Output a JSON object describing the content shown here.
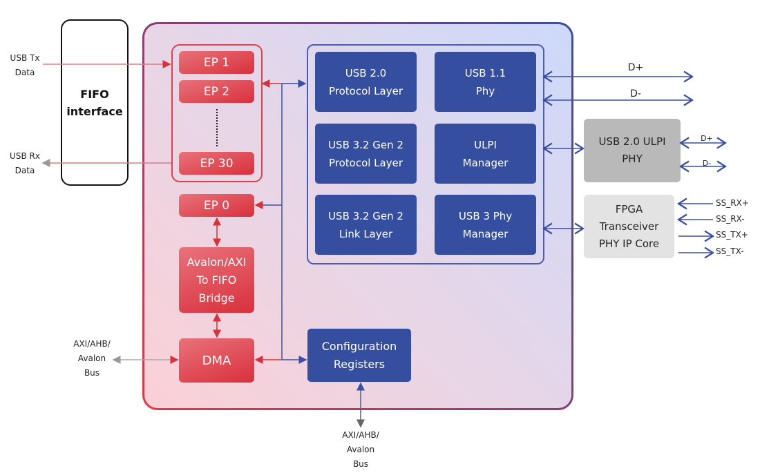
{
  "fifo": {
    "title_line1": "FIFO",
    "title_line2": "interface"
  },
  "external_labels": {
    "usb_tx": [
      "USB Tx",
      "Data"
    ],
    "usb_rx": [
      "USB Rx",
      "Data"
    ],
    "bus_left": [
      "AXI/AHB/",
      "Avalon",
      "Bus"
    ],
    "bus_bottom": [
      "AXI/AHB/",
      "Avalon",
      "Bus"
    ]
  },
  "endpoints": {
    "ep1": "EP 1",
    "ep2": "EP 2",
    "ep30": "EP 30",
    "ep0": "EP 0"
  },
  "bridge": [
    "Avalon/AXI",
    "To FIFO",
    "Bridge"
  ],
  "dma": "DMA",
  "config": [
    "Configuration",
    "Registers"
  ],
  "usb_blocks": [
    [
      "USB 2.0",
      "Protocol Layer"
    ],
    [
      "USB 1.1",
      "Phy"
    ],
    [
      "USB 3.2 Gen 2",
      "Protocol Layer"
    ],
    [
      "ULPI",
      "Manager"
    ],
    [
      "USB 3.2 Gen 2",
      "Link Layer"
    ],
    [
      "USB 3 Phy",
      "Manager"
    ]
  ],
  "ulpi_phy": [
    "USB 2.0 ULPI",
    "PHY"
  ],
  "transceiver": [
    "FPGA",
    "Transceiver",
    "PHY IP Core"
  ],
  "signals": {
    "dplus_main": "D+",
    "dminus_main": "D-",
    "dplus_ulpi": "D+",
    "dminus_ulpi": "D-",
    "ss_rx_plus": "SS_RX+",
    "ss_rx_minus": "SS_RX-",
    "ss_tx_plus": "SS_TX+",
    "ss_tx_minus": "SS_TX-"
  },
  "colors": {
    "red": "#d9303b",
    "blue": "#354ea0",
    "grey_dark": "#b9b9b9",
    "grey_light": "#e3e3e3"
  }
}
